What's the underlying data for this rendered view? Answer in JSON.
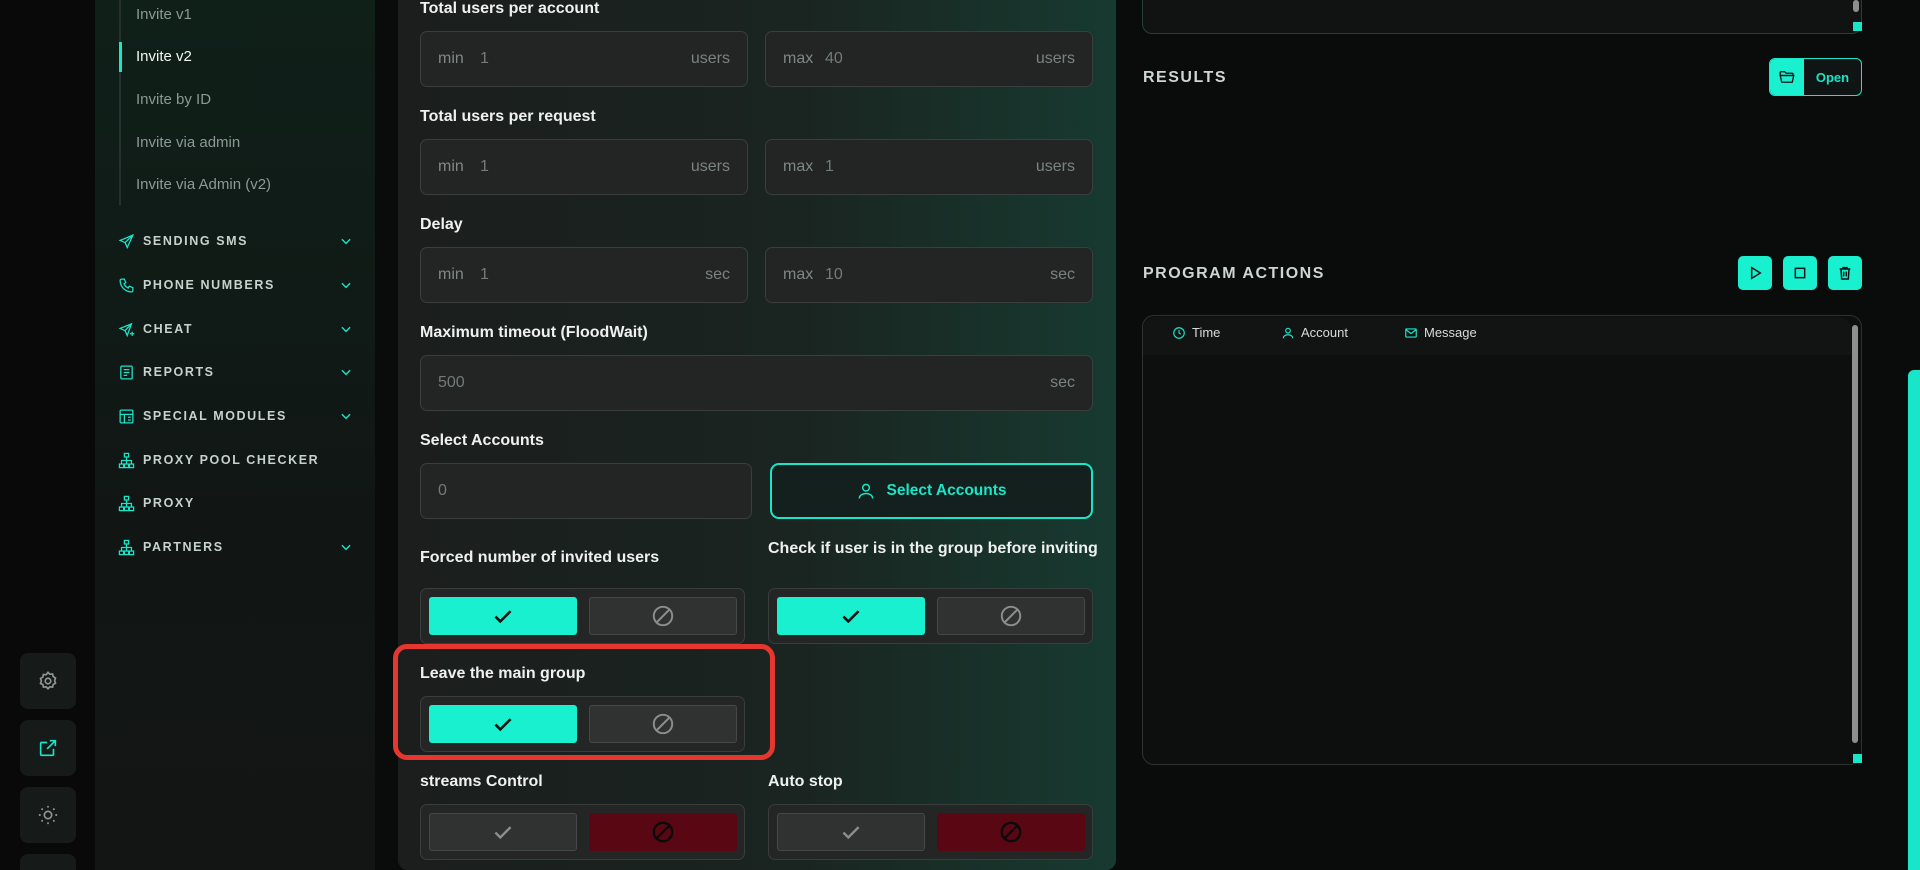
{
  "sidebar": {
    "sub_items": [
      "Invite v1",
      "Invite v2",
      "Invite by ID",
      "Invite via admin",
      "Invite via Admin (v2)"
    ],
    "active_sub_item": "Invite v2",
    "nav": [
      {
        "label": "SENDING SMS",
        "icon": "send-icon",
        "expandable": true
      },
      {
        "label": "PHONE NUMBERS",
        "icon": "phone-icon",
        "expandable": true
      },
      {
        "label": "CHEAT",
        "icon": "send-plus-icon",
        "expandable": true
      },
      {
        "label": "REPORTS",
        "icon": "report-icon",
        "expandable": true
      },
      {
        "label": "SPECIAL MODULES",
        "icon": "modules-icon",
        "expandable": true
      },
      {
        "label": "PROXY POOL CHECKER",
        "icon": "network-icon",
        "expandable": false
      },
      {
        "label": "PROXY",
        "icon": "network-icon",
        "expandable": false
      },
      {
        "label": "PARTNERS",
        "icon": "network-icon",
        "expandable": true
      }
    ]
  },
  "rail": [
    "settings-icon",
    "external-link-icon",
    "sun-icon"
  ],
  "form": {
    "total_users_account": {
      "label": "Total users per account",
      "min_prefix": "min",
      "min": "1",
      "max_prefix": "max",
      "max": "40",
      "unit": "users"
    },
    "total_users_request": {
      "label": "Total users per request",
      "min_prefix": "min",
      "min": "1",
      "max_prefix": "max",
      "max": "1",
      "unit": "users"
    },
    "delay": {
      "label": "Delay",
      "min_prefix": "min",
      "min": "1",
      "max_prefix": "max",
      "max": "10",
      "unit": "sec"
    },
    "max_timeout": {
      "label": "Maximum timeout (FloodWait)",
      "value": "500",
      "unit": "sec"
    },
    "select_accounts": {
      "label": "Select Accounts",
      "value": "0",
      "button": "Select Accounts"
    },
    "forced_number": {
      "label": "Forced number of invited users",
      "state": "on"
    },
    "check_in_group": {
      "label": "Check if user is in the group before inviting",
      "state": "on"
    },
    "leave_main_group": {
      "label": "Leave the main group",
      "state": "on"
    },
    "streams_control": {
      "label": "streams Control",
      "state": "off"
    },
    "auto_stop": {
      "label": "Auto stop",
      "state": "off"
    }
  },
  "results": {
    "title": "RESULTS",
    "open_label": "Open"
  },
  "program_actions": {
    "title": "PROGRAM ACTIONS",
    "buttons": [
      "play-icon",
      "stop-icon",
      "trash-icon"
    ],
    "columns": [
      "Time",
      "Account",
      "Message"
    ]
  },
  "colors": {
    "accent": "#19f0d0",
    "danger": "#5a0714",
    "highlight": "#e6372e"
  }
}
